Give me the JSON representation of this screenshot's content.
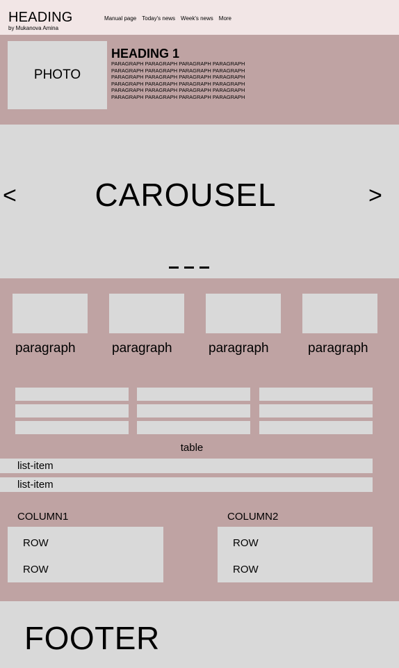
{
  "header": {
    "title": "HEADING",
    "byline": "by Mukanova Amina",
    "nav": [
      "Manual page",
      "Today's news",
      "Week's news",
      "More"
    ]
  },
  "hero": {
    "photo_label": "PHOTO",
    "heading": "HEADING 1",
    "paragraph_lines": [
      "PARAGRAPH PARAGRAPH PARAGRAPH PARAGRAPH",
      "PARAGRAPH PARAGRAPH PARAGRAPH PARAGRAPH",
      "PARAGRAPH PARAGRAPH PARAGRAPH PARAGRAPH",
      "PARAGRAPH PARAGRAPH PARAGRAPH PARAGRAPH",
      "PARAGRAPH PARAGRAPH PARAGRAPH PARAGRAPH",
      "PARAGRAPH PARAGRAPH PARAGRAPH PARAGRAPH"
    ]
  },
  "carousel": {
    "prev": "<",
    "next": ">",
    "label": "CAROUSEL",
    "dots": 3
  },
  "cards": [
    "paragraph",
    "paragraph",
    "paragraph",
    "paragraph"
  ],
  "table": {
    "columns": 3,
    "rows": 3,
    "label": "table"
  },
  "list": [
    "list-item",
    "list-item"
  ],
  "columns": [
    {
      "title": "COLUMN1",
      "rows": [
        "ROW",
        "ROW"
      ]
    },
    {
      "title": "COLUMN2",
      "rows": [
        "ROW",
        "ROW"
      ]
    }
  ],
  "footer": {
    "label": "FOOTER"
  },
  "colors": {
    "header_bg": "#f2e6e6",
    "accent_bg": "#bfa3a3",
    "placeholder_bg": "#d9d9d9",
    "text": "#000000"
  }
}
